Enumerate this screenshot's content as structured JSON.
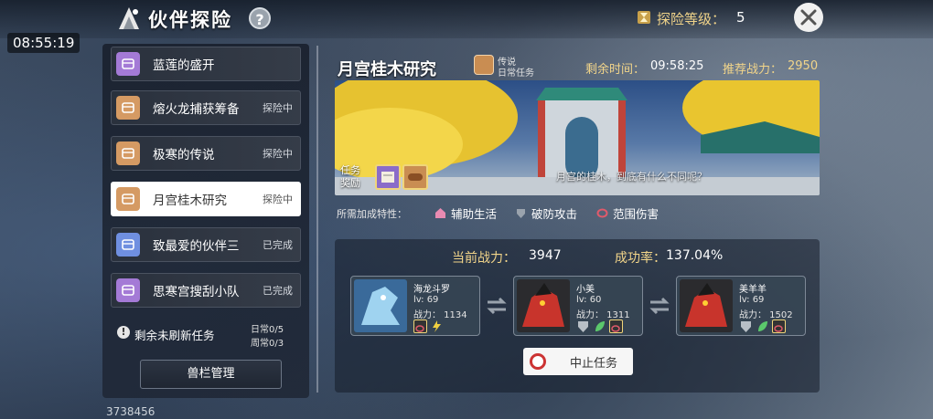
{
  "header": {
    "title": "伙伴探险",
    "help_label": "?",
    "clock": "08:55:19",
    "level_label": "探险等级：",
    "level_value": "5"
  },
  "sidebar": {
    "items": [
      {
        "name": "蓝莲的盛开",
        "state": "",
        "chest_color": "#a47ad6"
      },
      {
        "name": "熔火龙捕获筹备",
        "state": "探险中",
        "chest_color": "#d59a63"
      },
      {
        "name": "极寒的传说",
        "state": "探险中",
        "chest_color": "#d59a63"
      },
      {
        "name": "月宫桂木研究",
        "state": "探险中",
        "chest_color": "#d59a63"
      },
      {
        "name": "致最爱的伙伴三",
        "state": "已完成",
        "chest_color": "#6f8fe0"
      },
      {
        "name": "思寒宫搜刮小队",
        "state": "已完成",
        "chest_color": "#a47ad6"
      }
    ],
    "refresh_icon": "!",
    "refresh_label": "剩余未刷新任务",
    "daily": "日常0/5",
    "weekly": "周常0/3",
    "slot_button": "兽栏管理",
    "bottom_id": "3738456"
  },
  "mission": {
    "title": "月宫桂木研究",
    "tag_rarity": "传说",
    "tag_type": "日常任务",
    "time_label": "剩余时间：",
    "time_value": "09:58:25",
    "power_label": "推荐战力：",
    "power_value": "2950",
    "banner_caption": "月宫的桂木，到底有什么不同呢？",
    "reward_label_1": "任务",
    "reward_label_2": "奖励",
    "traits_label": "所需加成特性：",
    "traits": [
      "辅助生活",
      "破防攻击",
      "范围伤害"
    ]
  },
  "team": {
    "current_power_label": "当前战力：",
    "current_power_value": "3947",
    "success_label": "成功率：",
    "success_value": "137.04%",
    "pets": [
      {
        "name": "海龙斗罗",
        "level": "lv: 69",
        "power": "战力： 1134"
      },
      {
        "name": "小美",
        "level": "lv: 60",
        "power": "战力： 1311"
      },
      {
        "name": "美羊羊",
        "level": "lv: 69",
        "power": "战力： 1502"
      }
    ],
    "stop_button": "中止任务"
  },
  "colors": {
    "accent_gold": "#f2d58a",
    "stop_red": "#c33"
  }
}
